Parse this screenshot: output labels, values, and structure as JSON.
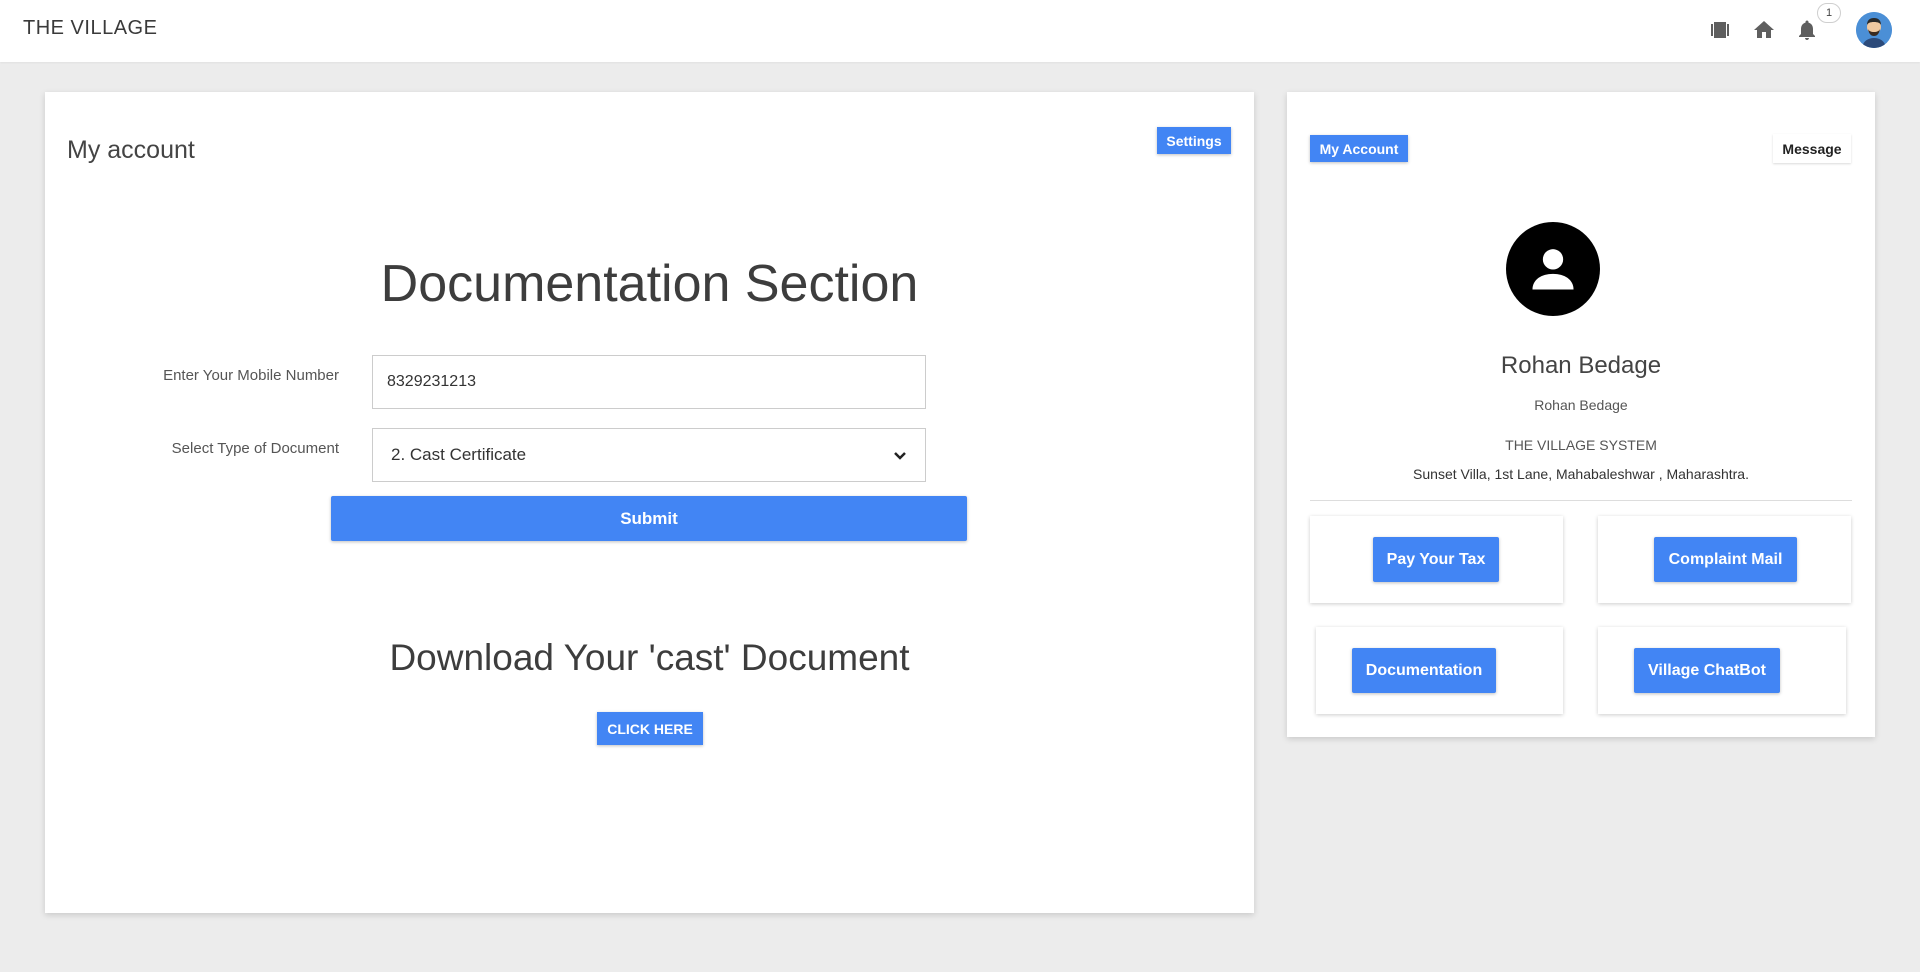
{
  "topbar": {
    "brand": "THE VILLAGE",
    "notification_count": "1",
    "icons": [
      "film-icon",
      "home-icon",
      "bell-icon",
      "user-avatar"
    ]
  },
  "main": {
    "title": "My account",
    "settings_label": "Settings",
    "section_title": "Documentation Section",
    "mobile_label": "Enter Your Mobile Number",
    "mobile_value": "8329231213",
    "doc_label": "Select Type of Document",
    "doc_selected": "2. Cast Certificate",
    "submit_label": "Submit",
    "download_title": "Download Your 'cast' Document",
    "click_label": "CLICK HERE"
  },
  "side": {
    "my_account_label": "My Account",
    "message_label": "Message",
    "name": "Rohan Bedage",
    "subname": "Rohan Bedage",
    "system": "THE VILLAGE SYSTEM",
    "address": "Sunset Villa, 1st Lane, Mahabaleshwar , Maharashtra.",
    "tiles": [
      {
        "label": "Pay Your Tax"
      },
      {
        "label": "Complaint Mail"
      },
      {
        "label": "Documentation"
      },
      {
        "label": "Village ChatBot"
      }
    ]
  },
  "colors": {
    "accent": "#4285f4",
    "background": "#ececec"
  }
}
